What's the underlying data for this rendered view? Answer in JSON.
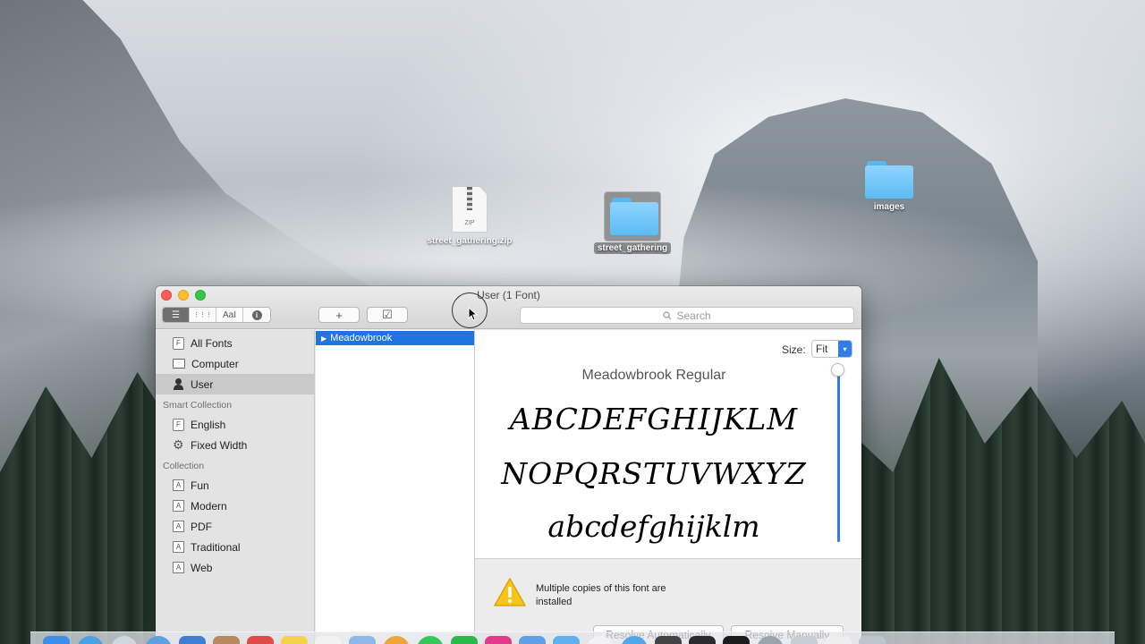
{
  "desktop": {
    "icons": [
      {
        "label": "street_gathering.zip",
        "type": "zip",
        "badge": "ZIP"
      },
      {
        "label": "street_gathering",
        "type": "folder",
        "selected": true
      },
      {
        "label": "images",
        "type": "folder",
        "selected": false
      }
    ]
  },
  "window": {
    "title": "User (1 Font)",
    "toolbar": {
      "view_buttons": [
        {
          "icon": "list-icon",
          "glyph": "☰"
        },
        {
          "icon": "grid-icon",
          "glyph": "⋮⋮⋮"
        },
        {
          "icon": "sample-icon",
          "glyph": "AaI"
        },
        {
          "icon": "info-icon",
          "glyph": "i"
        }
      ],
      "add_glyph": "+",
      "validate_glyph": "☑",
      "search_placeholder": "Search"
    },
    "sidebar": {
      "library_items": [
        {
          "label": "All Fonts",
          "icon": "font-file-icon",
          "glyph": "F"
        },
        {
          "label": "Computer",
          "icon": "computer-icon",
          "glyph": "🖵"
        },
        {
          "label": "User",
          "icon": "user-icon",
          "glyph": "👤",
          "selected": true
        }
      ],
      "smart_collection_header": "Smart Collection",
      "smart_items": [
        {
          "label": "English",
          "icon": "font-file-icon",
          "glyph": "F"
        },
        {
          "label": "Fixed Width",
          "icon": "gear-icon",
          "glyph": "⚙"
        }
      ],
      "collection_header": "Collection",
      "collection_items": [
        {
          "label": "Fun",
          "glyph": "A"
        },
        {
          "label": "Modern",
          "glyph": "A"
        },
        {
          "label": "PDF",
          "glyph": "A"
        },
        {
          "label": "Traditional",
          "glyph": "A"
        },
        {
          "label": "Web",
          "glyph": "A"
        }
      ]
    },
    "font_list": {
      "items": [
        {
          "label": "Meadowbrook",
          "selected": true
        }
      ]
    },
    "preview": {
      "size_label": "Size:",
      "size_value": "Fit",
      "font_name": "Meadowbrook Regular",
      "sample_line1": "ABCDEFGHIJKLM",
      "sample_line2": "NOPQRSTUVWXYZ",
      "sample_line3": "abcdefghijklm"
    },
    "warning": {
      "message": "Multiple copies of this font are installed",
      "resolve_auto": "Resolve Automatically",
      "resolve_manual": "Resolve Manually"
    }
  },
  "colors": {
    "selection_blue": "#1f74e0",
    "accent_blue": "#2e7de8",
    "close": "#fc5f57",
    "minimize": "#fdbc2e",
    "zoom": "#33c748"
  }
}
